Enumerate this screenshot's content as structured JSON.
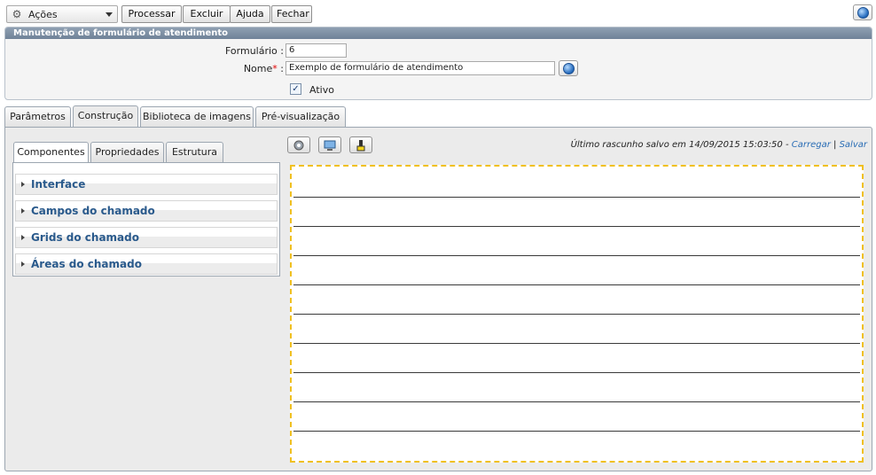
{
  "toolbar": {
    "actions_label": "Ações",
    "process_label": "Processar",
    "delete_label": "Excluir",
    "help_label": "Ajuda",
    "close_label": "Fechar"
  },
  "panel": {
    "title": "Manutenção de formulário de atendimento",
    "form_label": "Formulário :",
    "form_value": "6",
    "name_label": "Nome",
    "name_required": "*",
    "name_colon": ":",
    "name_value": "Exemplo de formulário de atendimento",
    "active_label": "Ativo",
    "active_checked": true
  },
  "tabs": [
    {
      "label": "Parâmetros",
      "active": false
    },
    {
      "label": "Construção",
      "active": true
    },
    {
      "label": "Biblioteca de imagens",
      "active": false
    },
    {
      "label": "Pré-visualização",
      "active": false
    }
  ],
  "subtabs": [
    {
      "label": "Componentes",
      "active": true
    },
    {
      "label": "Propriedades",
      "active": false
    },
    {
      "label": "Estrutura",
      "active": false
    }
  ],
  "accordion": [
    {
      "label": "Interface"
    },
    {
      "label": "Campos do chamado"
    },
    {
      "label": "Grids do chamado"
    },
    {
      "label": "Áreas do chamado"
    }
  ],
  "draft": {
    "text": "Último rascunho salvo em 14/09/2015 15:03:50 - ",
    "load": "Carregar",
    "sep": " | ",
    "save": "Salvar"
  },
  "icons": {
    "actions": "gear-icon",
    "globe": "globe-icon",
    "tool1": "settings-tool-icon",
    "tool2": "refresh-monitor-icon",
    "tool3": "cleanup-icon"
  },
  "colors": {
    "header_bar": "#6f8298",
    "canvas_border": "#f0c020",
    "accordion_text": "#2a5a8c",
    "link": "#2a6db5"
  }
}
